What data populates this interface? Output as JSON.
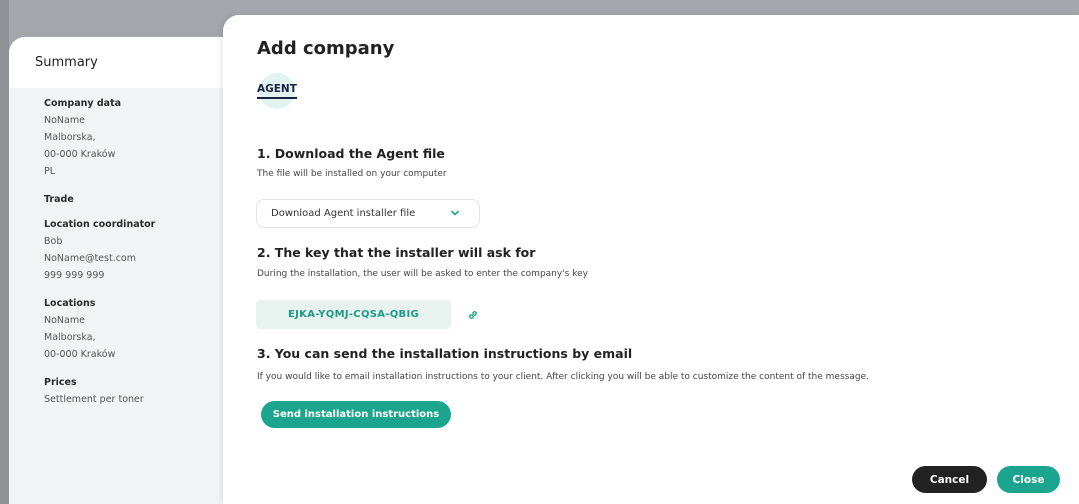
{
  "summary": {
    "title": "Summary",
    "company_data": {
      "label": "Company data",
      "lines": [
        "NoName",
        "Malborska,",
        "00-000 Kraków",
        "PL"
      ]
    },
    "trade": {
      "label": "Trade"
    },
    "location_coordinator": {
      "label": "Location coordinator",
      "lines": [
        "Bob",
        "NoName@test.com",
        "999 999 999"
      ]
    },
    "locations": {
      "label": "Locations",
      "lines": [
        "NoName",
        "Malborska,",
        "00-000 Kraków"
      ]
    },
    "prices": {
      "label": "Prices",
      "lines": [
        "Settlement per toner"
      ]
    }
  },
  "modal": {
    "title": "Add company",
    "tab": "AGENT",
    "step1": {
      "title": "1. Download the Agent file",
      "desc": "The file will be installed on your computer",
      "select_value": "Download Agent installer file"
    },
    "step2": {
      "title": "2. The key that the installer will ask for",
      "desc": "During the installation, the user will be asked to enter the company's key",
      "key": "EJKA-YQMJ-CQSA-QBIG"
    },
    "step3": {
      "title": "3. You can send the installation instructions by email",
      "desc": "If you would like to email installation instructions to your client. After clicking you will be able to customize the content of the message.",
      "button": "Send installation instructions"
    },
    "footer": {
      "cancel": "Cancel",
      "close": "Close"
    }
  },
  "colors": {
    "accent": "#1ba58f",
    "dark_button": "#222222",
    "key_bg": "#e8f2ef"
  },
  "icons": {
    "select": "chevron-down-icon",
    "key": "link-icon"
  }
}
